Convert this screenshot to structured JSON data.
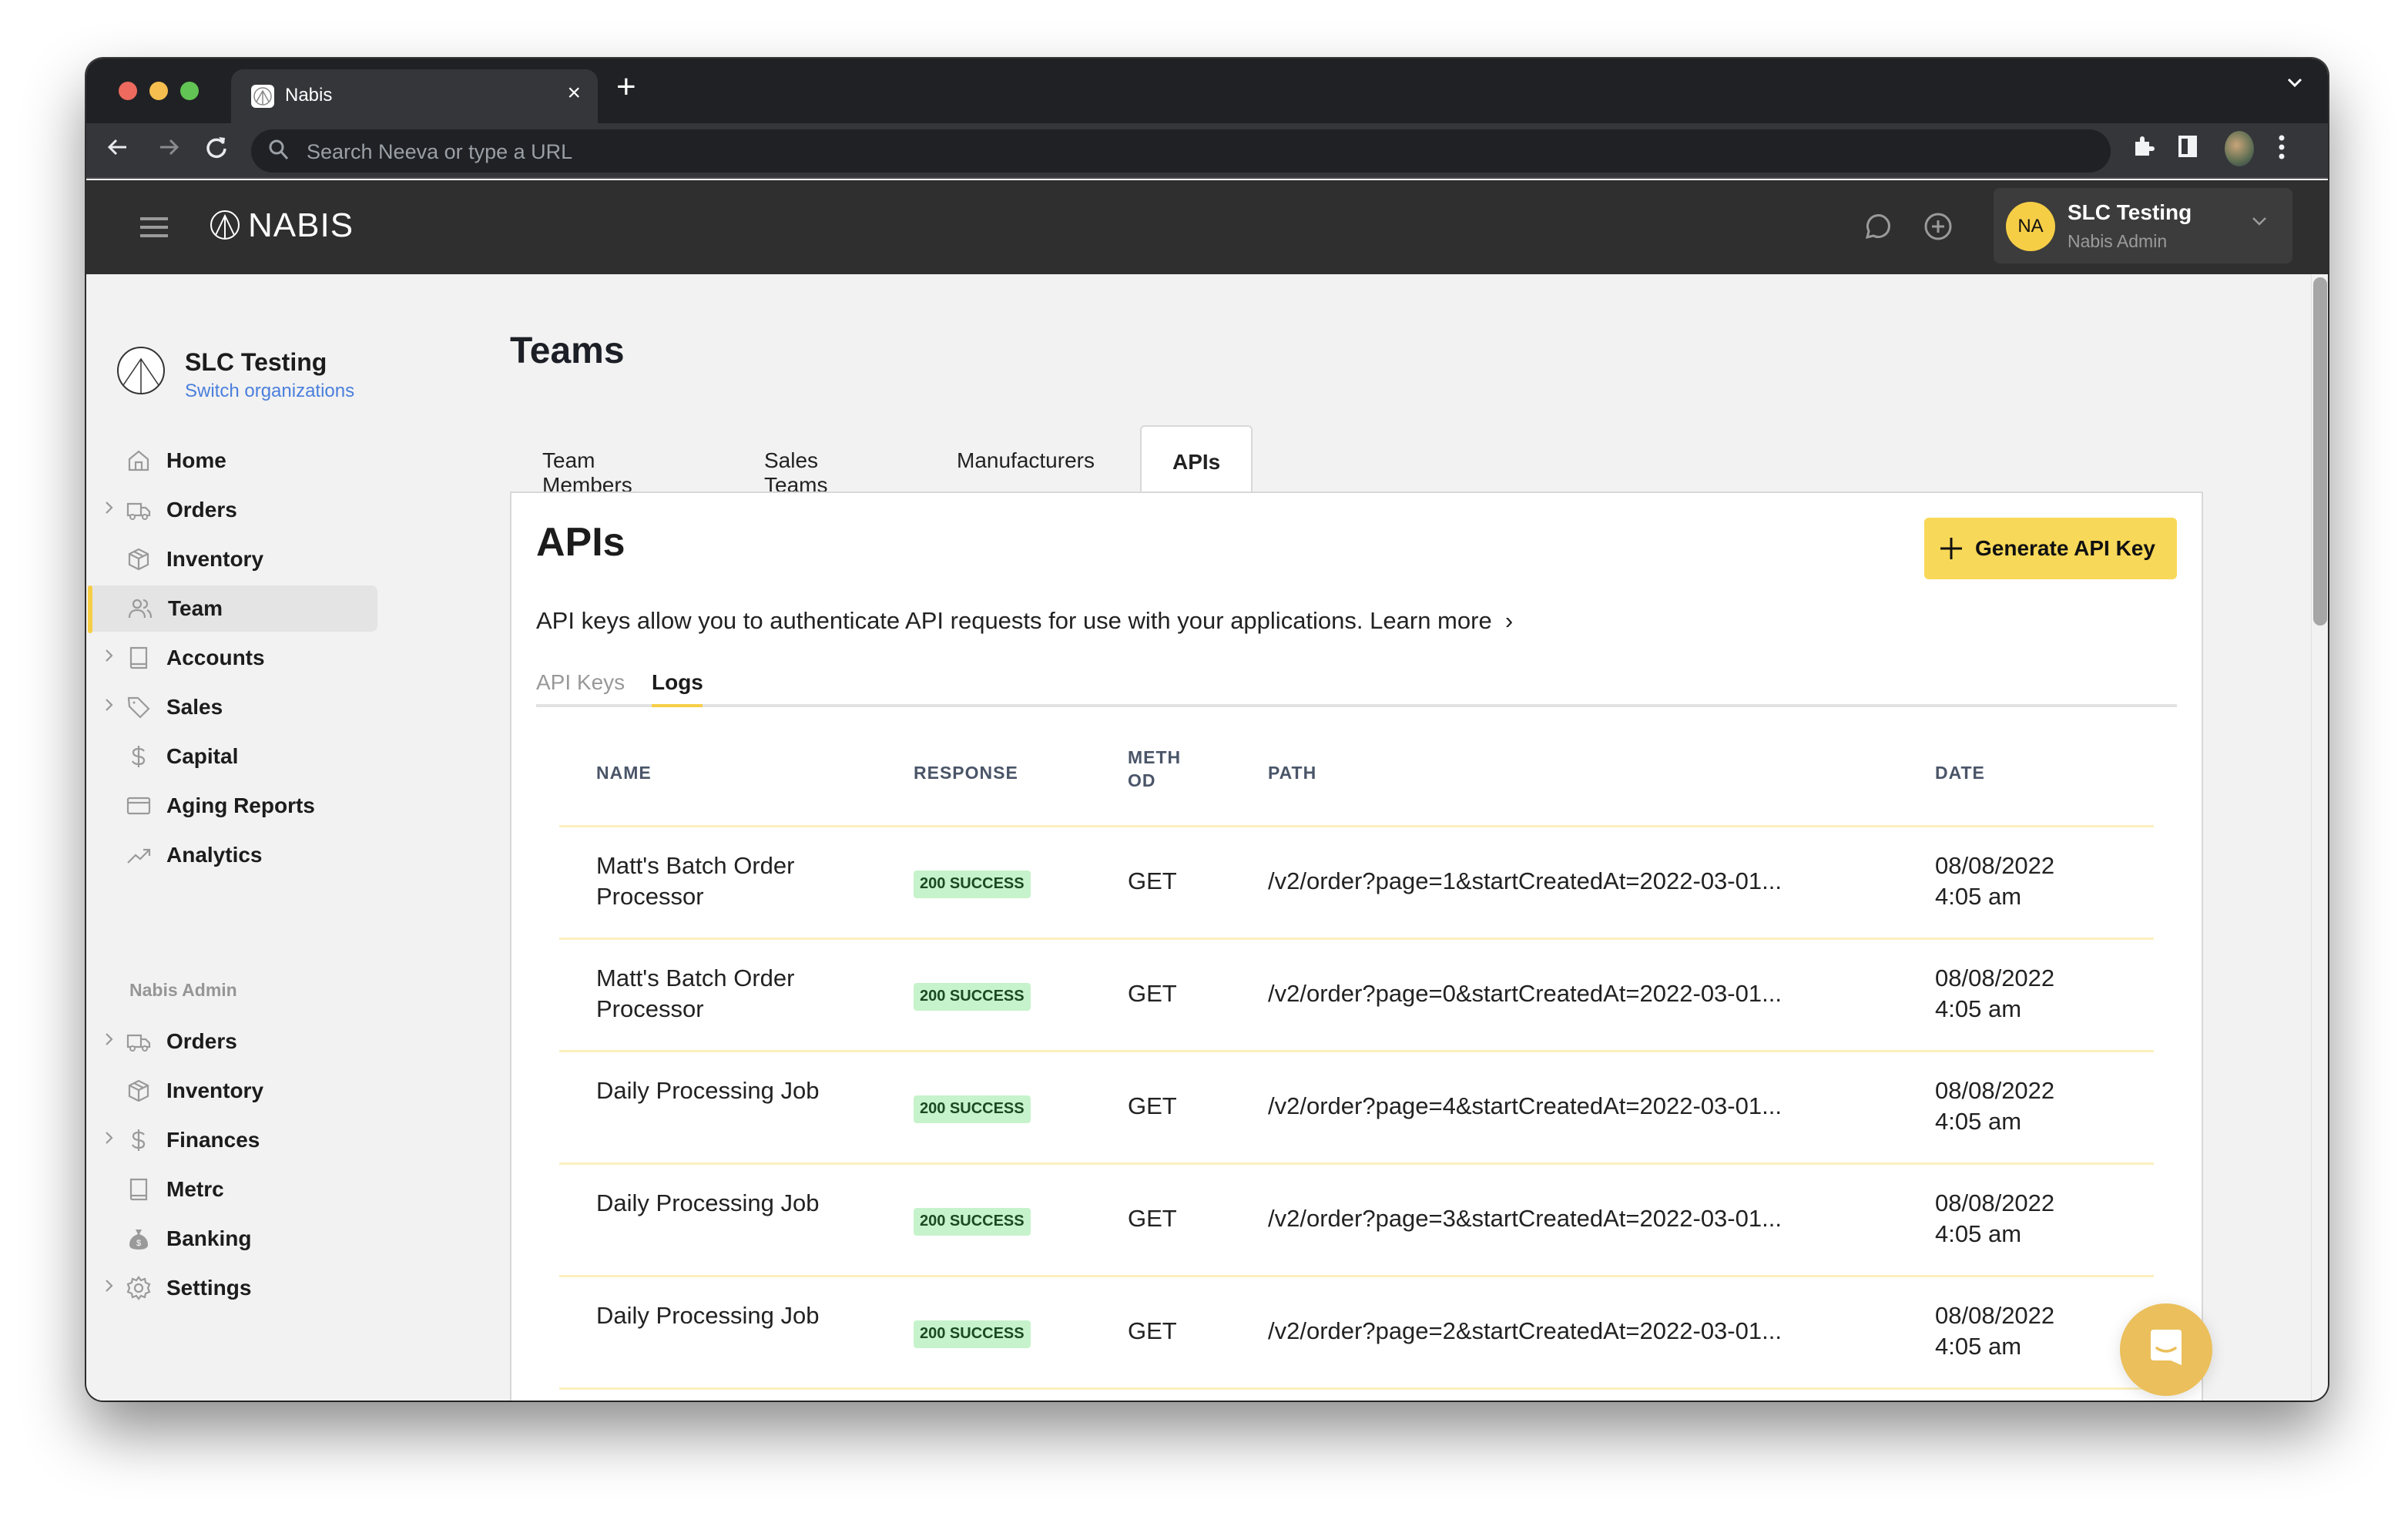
{
  "browser": {
    "tab_title": "Nabis",
    "close_glyph": "×",
    "new_tab_glyph": "+",
    "overflow_glyph": "⌄",
    "omnibox_placeholder": "Search Neeva or type a URL",
    "icons": [
      "back-icon",
      "forward-icon",
      "reload-icon",
      "search-icon",
      "extensions-icon",
      "side-panel-icon",
      "profile-avatar",
      "kebab-menu-icon"
    ]
  },
  "appbar": {
    "logo_text": "NABIS",
    "org_initials": "NA",
    "org_name": "SLC Testing",
    "org_role": "Nabis Admin",
    "accent_color": "#f6ce46"
  },
  "sidebar": {
    "org_name": "SLC Testing",
    "switch_label": "Switch organizations",
    "items": [
      {
        "label": "Home",
        "icon": "home-icon",
        "expandable": false,
        "active": false
      },
      {
        "label": "Orders",
        "icon": "truck-icon",
        "expandable": true,
        "active": false
      },
      {
        "label": "Inventory",
        "icon": "box-icon",
        "expandable": false,
        "active": false
      },
      {
        "label": "Team",
        "icon": "users-icon",
        "expandable": false,
        "active": true
      },
      {
        "label": "Accounts",
        "icon": "book-icon",
        "expandable": true,
        "active": false
      },
      {
        "label": "Sales",
        "icon": "tag-icon",
        "expandable": true,
        "active": false
      },
      {
        "label": "Capital",
        "icon": "dollar-icon",
        "expandable": false,
        "active": false
      },
      {
        "label": "Aging Reports",
        "icon": "card-icon",
        "expandable": false,
        "active": false
      },
      {
        "label": "Analytics",
        "icon": "trend-icon",
        "expandable": false,
        "active": false
      }
    ],
    "admin_section_label": "Nabis Admin",
    "admin_items": [
      {
        "label": "Orders",
        "icon": "truck-icon",
        "expandable": true
      },
      {
        "label": "Inventory",
        "icon": "box-icon",
        "expandable": false
      },
      {
        "label": "Finances",
        "icon": "dollar-icon",
        "expandable": true
      },
      {
        "label": "Metrc",
        "icon": "book-icon",
        "expandable": false
      },
      {
        "label": "Banking",
        "icon": "money-bag-icon",
        "expandable": false
      },
      {
        "label": "Settings",
        "icon": "gear-icon",
        "expandable": true
      }
    ]
  },
  "main": {
    "page_title": "Teams",
    "tabs": [
      {
        "label": "Team Members",
        "active": false
      },
      {
        "label": "Sales Teams",
        "active": false
      },
      {
        "label": "Manufacturers",
        "active": false
      },
      {
        "label": "APIs",
        "active": true
      }
    ],
    "card": {
      "title": "APIs",
      "generate_button": "Generate API Key",
      "description": "API keys allow you to authenticate API requests for use with your applications.",
      "learn_more": "Learn more",
      "learn_more_chevron": "›",
      "subtabs": [
        {
          "label": "API Keys",
          "active": false
        },
        {
          "label": "Logs",
          "active": true
        }
      ]
    },
    "table": {
      "columns": [
        "NAME",
        "RESPONSE",
        "METH OD",
        "PATH",
        "DATE"
      ],
      "method_header_lines": [
        "METH",
        "OD"
      ],
      "rows": [
        {
          "name": "Matt's Batch Order Processor",
          "response": "200 SUCCESS",
          "method": "GET",
          "path": "/v2/order?page=1&startCreatedAt=2022-03-01...",
          "date": "08/08/2022",
          "time": "4:05 am"
        },
        {
          "name": "Matt's Batch Order Processor",
          "response": "200 SUCCESS",
          "method": "GET",
          "path": "/v2/order?page=0&startCreatedAt=2022-03-01...",
          "date": "08/08/2022",
          "time": "4:05 am"
        },
        {
          "name": "Daily Processing Job",
          "response": "200 SUCCESS",
          "method": "GET",
          "path": "/v2/order?page=4&startCreatedAt=2022-03-01...",
          "date": "08/08/2022",
          "time": "4:05 am"
        },
        {
          "name": "Daily Processing Job",
          "response": "200 SUCCESS",
          "method": "GET",
          "path": "/v2/order?page=3&startCreatedAt=2022-03-01...",
          "date": "08/08/2022",
          "time": "4:05 am"
        },
        {
          "name": "Daily Processing Job",
          "response": "200 SUCCESS",
          "method": "GET",
          "path": "/v2/order?page=2&startCreatedAt=2022-03-01...",
          "date": "08/08/2022",
          "time": "4:05 am"
        }
      ]
    }
  },
  "colors": {
    "primary_button": "#f8d858",
    "success_badge_bg": "#c6f3cb",
    "success_badge_text": "#1b4a22",
    "link": "#4a7fdc",
    "chat_widget": "#ebbf5b"
  },
  "scroll": {
    "position_fraction": 0.0,
    "visible_fraction": 0.31
  }
}
